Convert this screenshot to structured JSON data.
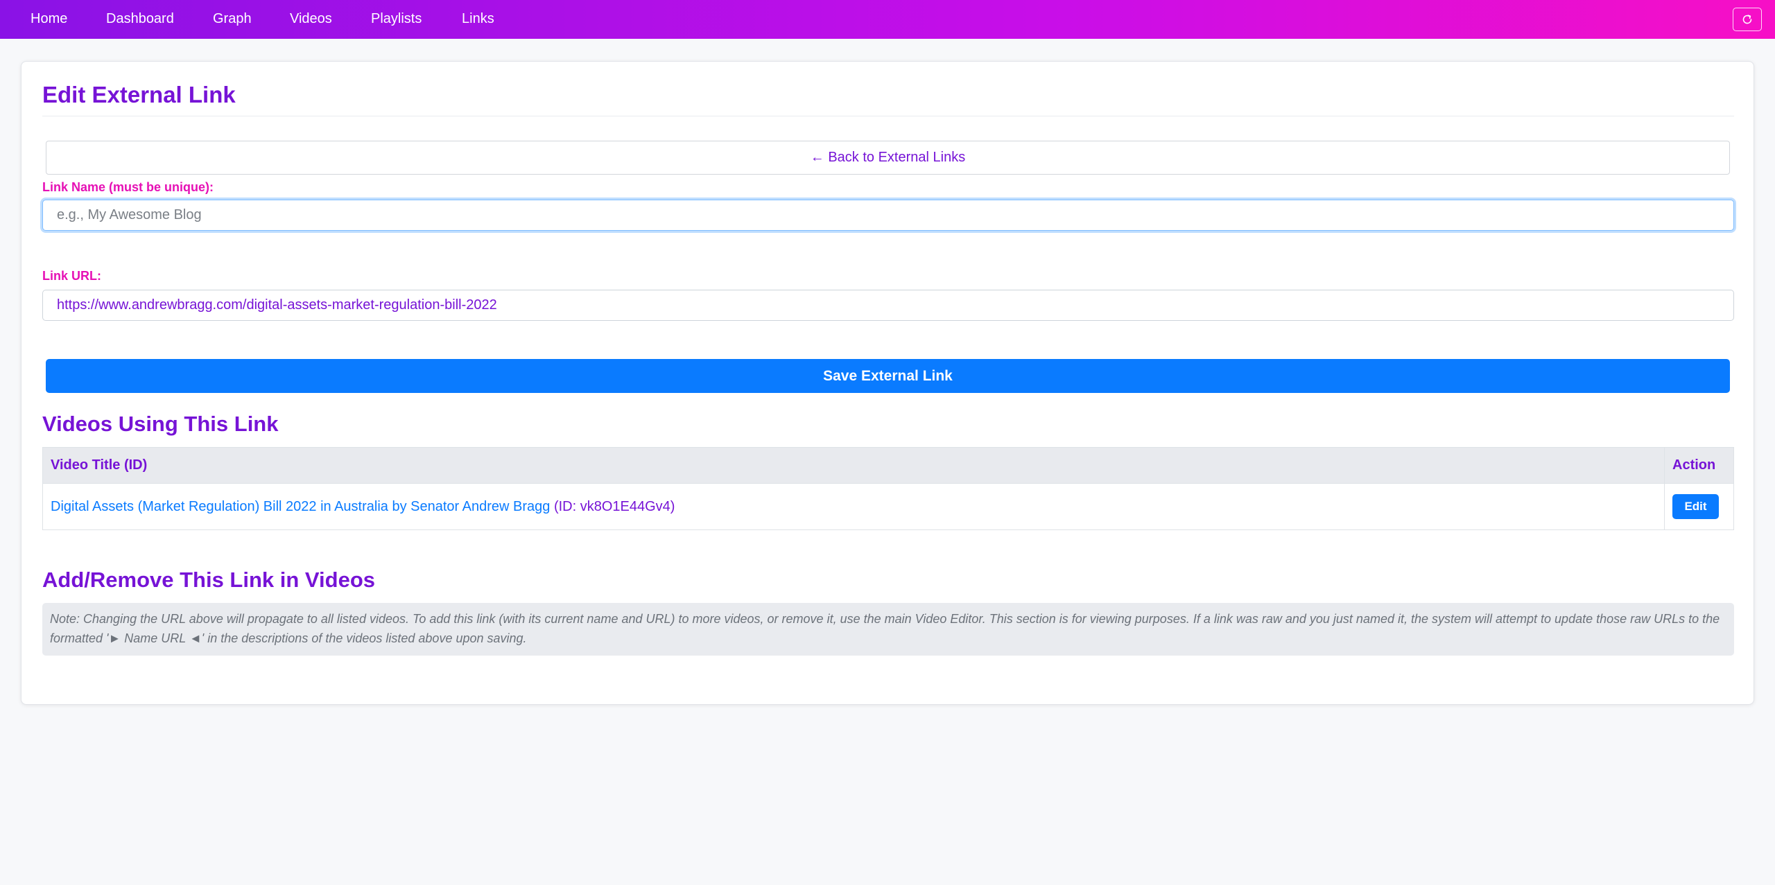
{
  "nav": {
    "items": [
      {
        "label": "Home"
      },
      {
        "label": "Dashboard"
      },
      {
        "label": "Graph"
      },
      {
        "label": "Videos"
      },
      {
        "label": "Playlists"
      },
      {
        "label": "Links"
      }
    ],
    "refresh_icon": "refresh-icon"
  },
  "page": {
    "title": "Edit External Link",
    "back_label": "← Back to External Links"
  },
  "form": {
    "name_label": "Link Name (must be unique):",
    "name_value": "",
    "name_placeholder": "e.g., My Awesome Blog",
    "url_label": "Link URL:",
    "url_value": "https://www.andrewbragg.com/digital-assets-market-regulation-bill-2022",
    "save_label": "Save External Link"
  },
  "videos_section": {
    "title": "Videos Using This Link",
    "columns": [
      "Video Title (ID)",
      "Action"
    ],
    "rows": [
      {
        "title": "Digital Assets (Market Regulation) Bill 2022 in Australia by Senator Andrew Bragg",
        "id_text": "(ID: vk8O1E44Gv4)",
        "action_label": "Edit"
      }
    ]
  },
  "add_remove_section": {
    "title": "Add/Remove This Link in Videos",
    "note": "Note: Changing the URL above will propagate to all listed videos. To add this link (with its current name and URL) to more videos, or remove it, use the main Video Editor. This section is for viewing purposes. If a link was raw and you just named it, the system will attempt to update those raw URLs to the formatted '► Name URL ◄' in the descriptions of the videos listed above upon saving."
  },
  "colors": {
    "accent_purple": "#7613d6",
    "label_pink": "#e610b5",
    "primary_blue": "#0a7bff",
    "nav_gradient_start": "#8a12e6",
    "nav_gradient_end": "#f70fc6"
  }
}
